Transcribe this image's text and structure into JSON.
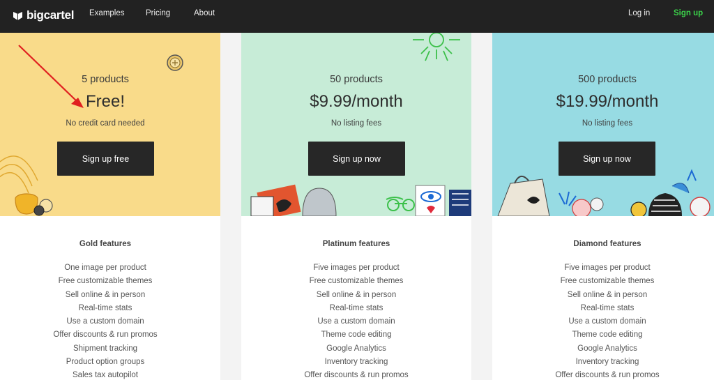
{
  "header": {
    "brand": "bigcartel",
    "nav": [
      "Examples",
      "Pricing",
      "About"
    ],
    "login": "Log in",
    "signup": "Sign up",
    "colors": {
      "bar": "#222222",
      "signup": "#3bd24a"
    }
  },
  "plans": [
    {
      "tier": "Gold",
      "products": "5 products",
      "price": "Free!",
      "note": "No credit card needed",
      "button": "Sign up free",
      "features_title": "Gold features",
      "features": [
        "One image per product",
        "Free customizable themes",
        "Sell online & in person",
        "Real-time stats",
        "Use a custom domain",
        "Offer discounts & run promos",
        "Shipment tracking",
        "Product option groups",
        "Sales tax autopilot"
      ],
      "color": "#f9db8a"
    },
    {
      "tier": "Platinum",
      "products": "50 products",
      "price": "$9.99/month",
      "note": "No listing fees",
      "button": "Sign up now",
      "features_title": "Platinum features",
      "features": [
        "Five images per product",
        "Free customizable themes",
        "Sell online & in person",
        "Real-time stats",
        "Use a custom domain",
        "Theme code editing",
        "Google Analytics",
        "Inventory tracking",
        "Offer discounts & run promos"
      ],
      "color": "#c7ecd7"
    },
    {
      "tier": "Diamond",
      "products": "500 products",
      "price": "$19.99/month",
      "note": "No listing fees",
      "button": "Sign up now",
      "features_title": "Diamond features",
      "features": [
        "Five images per product",
        "Free customizable themes",
        "Sell online & in person",
        "Real-time stats",
        "Use a custom domain",
        "Theme code editing",
        "Google Analytics",
        "Inventory tracking",
        "Offer discounts & run promos"
      ],
      "color": "#97dbe3"
    }
  ],
  "annotation": {
    "icon": "red-arrow-icon",
    "color": "#e02020"
  }
}
